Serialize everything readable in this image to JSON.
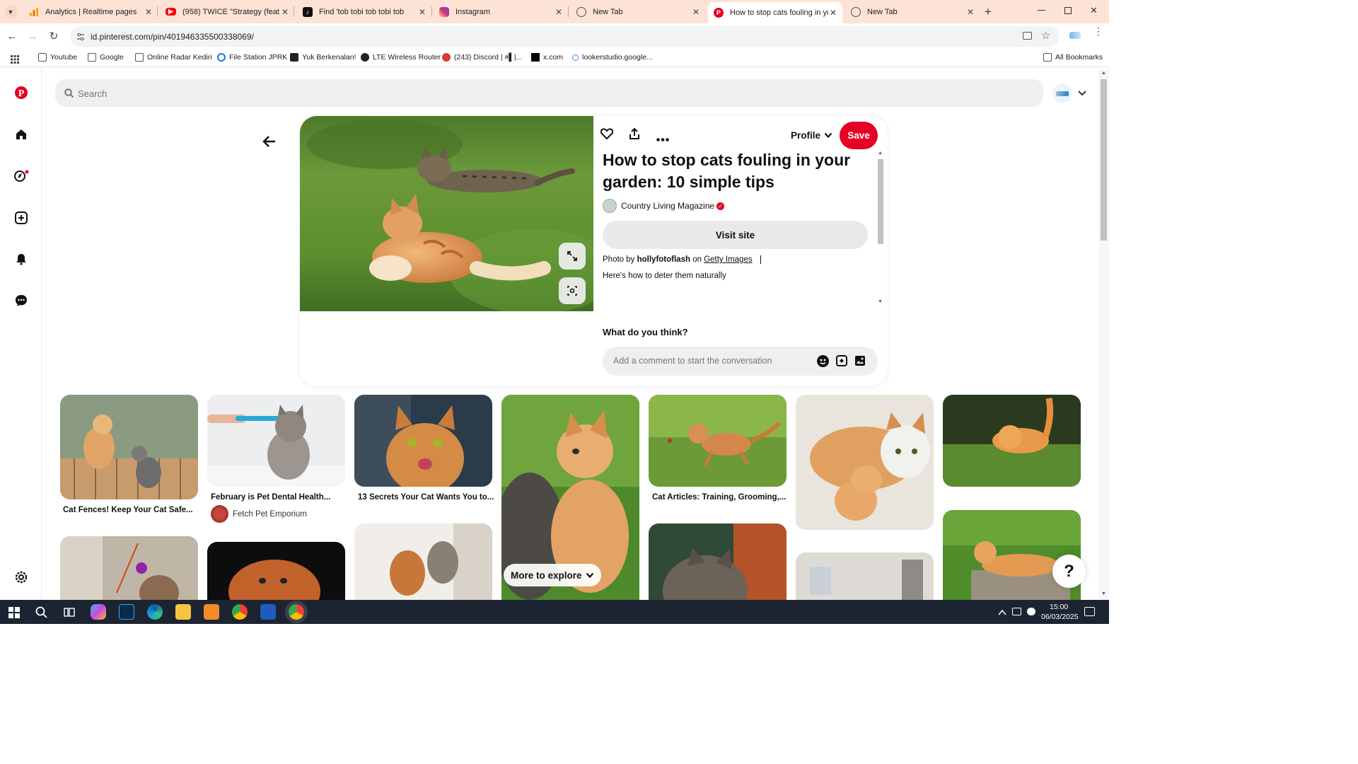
{
  "browser": {
    "tabs": [
      {
        "title": "Analytics | Realtime pages",
        "icon": "analytics-icon"
      },
      {
        "title": "(958) TWICE \"Strategy (feat. Me",
        "icon": "youtube-icon"
      },
      {
        "title": "Find 'tob tobi tob tobi tob",
        "icon": "tiktok-icon"
      },
      {
        "title": "Instagram",
        "icon": "instagram-icon"
      },
      {
        "title": "New Tab",
        "icon": "globe-icon"
      },
      {
        "title": "How to stop cats fouling in you",
        "icon": "pinterest-icon"
      },
      {
        "title": "New Tab",
        "icon": "globe-icon"
      }
    ],
    "url": "id.pinterest.com/pin/401946335500338069/",
    "bookmarks": [
      {
        "label": "Youtube"
      },
      {
        "label": "Google"
      },
      {
        "label": "Online Radar Kediri"
      },
      {
        "label": "File Station JPRK"
      },
      {
        "label": "Yuk Berkenalan!"
      },
      {
        "label": "LTE Wireless Router"
      },
      {
        "label": "(243) Discord | #▌|..."
      },
      {
        "label": "x.com"
      },
      {
        "label": "lookerstudio.google..."
      }
    ],
    "all_bookmarks": "All Bookmarks"
  },
  "pinterest": {
    "search_placeholder": "Search",
    "pin": {
      "title": "How to stop cats fouling in your garden: 10 simple tips",
      "profile_label": "Profile",
      "save_label": "Save",
      "source_name": "Country Living Magazine",
      "visit_label": "Visit site",
      "photo_by_prefix": "Photo by",
      "photographer": "hollyfotoflash",
      "on": "on",
      "agency": "Getty Images",
      "description": "Here's how to deter them naturally",
      "comment_heading": "What do you think?",
      "comment_placeholder": "Add a comment to start the conversation"
    },
    "feed": [
      {
        "title": "Cat Fences! Keep Your Cat Safe..."
      },
      {
        "title": "February is Pet Dental Health...",
        "author": "Fetch Pet Emporium"
      },
      {
        "title": "13 Secrets Your Cat Wants You to..."
      },
      {
        "title": ""
      },
      {
        "title": "Cat Articles: Training, Grooming,..."
      }
    ],
    "more_to_explore": "More to explore",
    "help": "?"
  },
  "taskbar": {
    "time": "15:00",
    "date": "06/03/2025"
  }
}
